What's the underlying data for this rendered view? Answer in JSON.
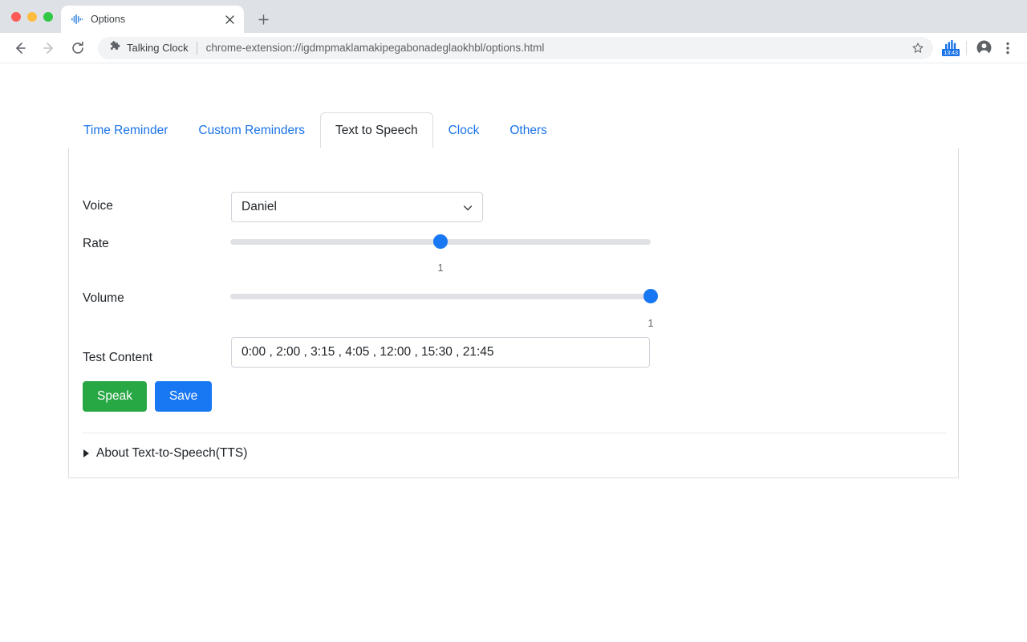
{
  "browser": {
    "window_controls": [
      "close",
      "minimize",
      "maximize"
    ],
    "tab": {
      "title": "Options",
      "favicon": "waveform-icon",
      "close_icon": "close-icon"
    },
    "new_tab_label": "+",
    "nav": {
      "back_icon": "back-arrow-icon",
      "forward_icon": "forward-arrow-icon",
      "reload_icon": "reload-icon"
    },
    "omnibox": {
      "extension_icon": "puzzle-piece-icon",
      "extension_name": "Talking Clock",
      "url": "chrome-extension://igdmpmaklamakipegabonadeglaokhbl/options.html",
      "star_icon": "bookmark-star-icon"
    },
    "toolbar": {
      "extension_action_icon": "bar-chart-clock-icon",
      "extension_badge": "13:43",
      "profile_icon": "profile-avatar-icon",
      "menu_icon": "three-dot-menu-icon",
      "badge_color": "#1a73e8"
    }
  },
  "tabs": [
    {
      "label": "Time Reminder",
      "active": false
    },
    {
      "label": "Custom Reminders",
      "active": false
    },
    {
      "label": "Text to Speech",
      "active": true
    },
    {
      "label": "Clock",
      "active": false
    },
    {
      "label": "Others",
      "active": false
    }
  ],
  "form": {
    "voice": {
      "label": "Voice",
      "selected": "Daniel",
      "chevron_icon": "chevron-down-icon"
    },
    "rate": {
      "label": "Rate",
      "value": "1",
      "percent": 50
    },
    "volume": {
      "label": "Volume",
      "value": "1",
      "percent": 100
    },
    "test_content": {
      "label": "Test Content",
      "value": "0:00 , 2:00 , 3:15 , 4:05 , 12:00 , 15:30 , 21:45"
    },
    "buttons": {
      "speak": "Speak",
      "save": "Save",
      "speak_color": "#28a745",
      "save_color": "#1877f2"
    },
    "details": {
      "label": "About Text-to-Speech(TTS)",
      "expanded": false,
      "marker_icon": "disclosure-triangle-icon"
    }
  }
}
